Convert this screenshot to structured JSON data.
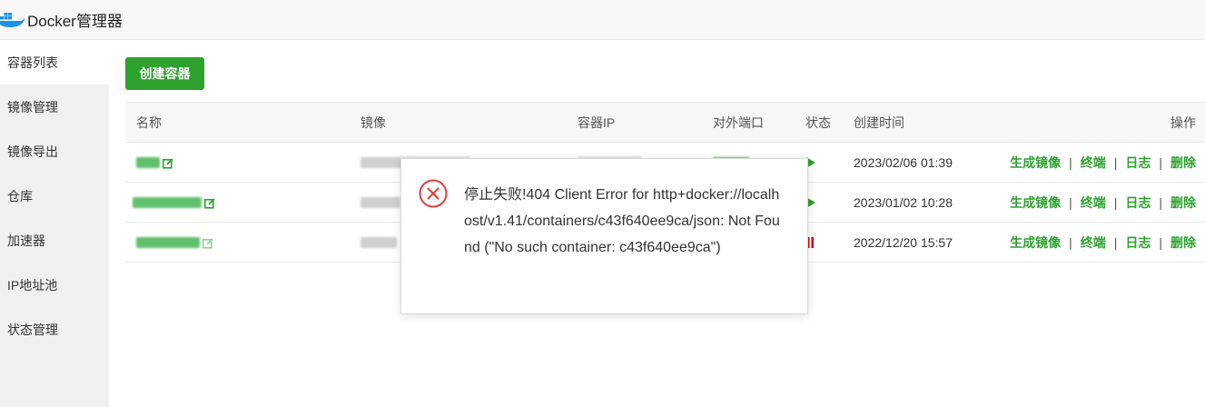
{
  "app": {
    "title": "Docker管理器"
  },
  "sidebar": {
    "items": [
      {
        "label": "容器列表",
        "active": true
      },
      {
        "label": "镜像管理"
      },
      {
        "label": "镜像导出"
      },
      {
        "label": "仓库"
      },
      {
        "label": "加速器"
      },
      {
        "label": "IP地址池"
      },
      {
        "label": "状态管理"
      }
    ]
  },
  "toolbar": {
    "create_label": "创建容器"
  },
  "table": {
    "columns": [
      "名称",
      "镜像",
      "容器IP",
      "对外端口",
      "状态",
      "创建时间",
      "操作"
    ],
    "rows": [
      {
        "created": "2023/02/06 01:39",
        "state": "running"
      },
      {
        "created": "2023/01/02 10:28",
        "state": "running"
      },
      {
        "created": "2022/12/20 15:57",
        "state": "paused"
      }
    ],
    "ops": [
      "生成镜像",
      "终端",
      "日志",
      "删除"
    ],
    "separator": "|"
  },
  "dialog": {
    "message": "停止失败!404 Client Error for http+docker://localhost/v1.41/containers/c43f640ee9ca/json: Not Found (\"No such container: c43f640ee9ca\")"
  },
  "colors": {
    "accent": "#2ea12e",
    "error": "#e04040",
    "pause": "#d40000"
  }
}
